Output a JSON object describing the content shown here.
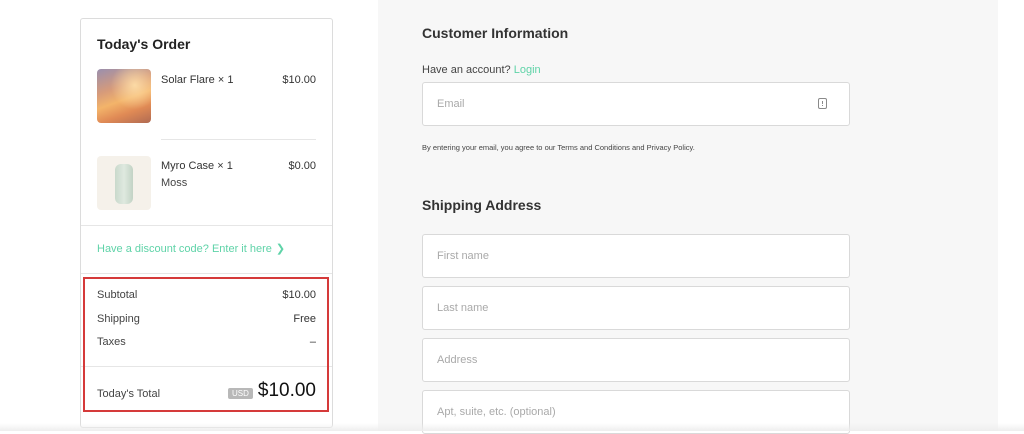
{
  "order": {
    "title": "Today's Order",
    "items": [
      {
        "name": "Solar Flare × 1",
        "variant": "",
        "price": "$10.00",
        "thumb_icon": "sunset-image"
      },
      {
        "name": "Myro Case × 1",
        "variant": "Moss",
        "price": "$0.00",
        "thumb_icon": "case-image"
      }
    ],
    "discount_link": "Have a discount code? Enter it here",
    "summary": {
      "subtotal_label": "Subtotal",
      "subtotal_value": "$10.00",
      "shipping_label": "Shipping",
      "shipping_value": "Free",
      "taxes_label": "Taxes",
      "taxes_value": "–"
    },
    "total": {
      "label": "Today's Total",
      "currency": "USD",
      "value": "$10.00"
    }
  },
  "customer": {
    "title": "Customer Information",
    "account_prompt": "Have an account?",
    "login_label": "Login",
    "email_placeholder": "Email",
    "terms_text": "By entering your email, you agree to our Terms and Conditions and Privacy Policy."
  },
  "shipping": {
    "title": "Shipping Address",
    "first_name_placeholder": "First name",
    "last_name_placeholder": "Last name",
    "address_placeholder": "Address",
    "apt_placeholder": "Apt, suite, etc. (optional)"
  },
  "colors": {
    "accent": "#5fd3a8",
    "highlight": "#d53a3a"
  }
}
